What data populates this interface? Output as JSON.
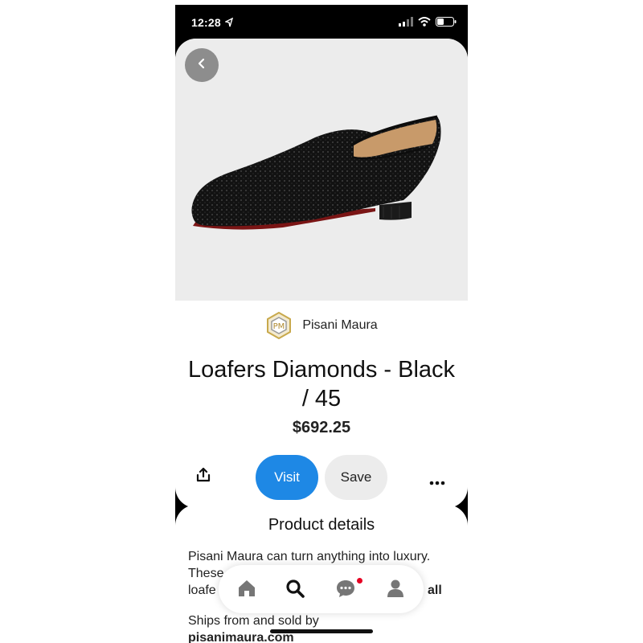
{
  "status_bar": {
    "time": "12:28"
  },
  "product": {
    "brand_name": "Pisani Maura",
    "title": "Loafers Diamonds - Black / 45",
    "price": "$692.25"
  },
  "actions": {
    "visit_label": "Visit",
    "save_label": "Save"
  },
  "details": {
    "heading": "Product details",
    "description": "Pisani Maura can turn anything into luxury. These ... loafe ... all",
    "description_line1": "Pisani Maura can turn anything into luxury.",
    "description_line2": "These",
    "description_line3_start": "loafe",
    "description_line3_end": "all",
    "ships_line1": "Ships from and sold by",
    "ships_line2": "pisanimaura.com"
  },
  "bottom_nav": {
    "items": [
      "home-icon",
      "search-icon",
      "messages-icon",
      "profile-icon"
    ],
    "active": "search-icon",
    "notification_color": "#e60023"
  },
  "colors": {
    "visit": "#1e88e5",
    "save": "#ececec"
  }
}
